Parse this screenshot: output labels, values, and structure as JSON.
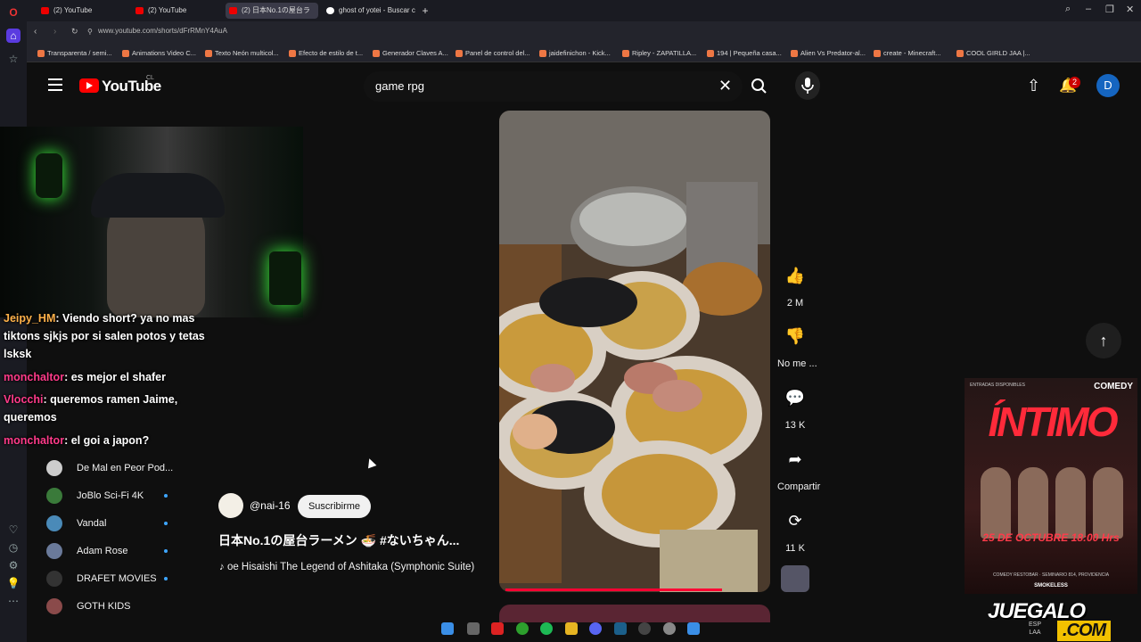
{
  "browser": {
    "tabs": [
      {
        "label": "(2) YouTube",
        "active": false
      },
      {
        "label": "(2) YouTube",
        "active": false
      },
      {
        "label": "(2) 日本No.1の屋台ラ",
        "active": true
      },
      {
        "label": "ghost of yotei - Buscar co",
        "active": false
      }
    ],
    "url": "www.youtube.com/shorts/dFrRMnY4AuA",
    "bookmarks": [
      "Transparenta / semi...",
      "Animations Video C...",
      "Texto Neón multicol...",
      "Efecto de estilo de t...",
      "Generador Claves A...",
      "Panel de control del...",
      "jaidefinichon - Kick...",
      "Ripley - ZAPATILLA...",
      "194 | Pequeña casa...",
      "Alien Vs Predator-al...",
      "create - Minecraft...",
      "COOL GIRLD JAA |..."
    ]
  },
  "header": {
    "brand": "YouTube",
    "country": "CL",
    "search_value": "game rpg",
    "notifications": "2",
    "avatar": "D"
  },
  "sidebar": {
    "subs": [
      {
        "name": "De Mal en Peor Pod...",
        "dot": false
      },
      {
        "name": "JoBlo Sci-Fi 4K",
        "dot": true
      },
      {
        "name": "Vandal",
        "dot": true
      },
      {
        "name": "Adam Rose",
        "dot": true
      },
      {
        "name": "DRAFET MOVIES",
        "dot": true
      },
      {
        "name": "GOTH KIDS",
        "dot": false
      }
    ]
  },
  "chat": [
    {
      "user": "Jeipy_HM",
      "text": ": Viendo short? ya no mas tiktons sjkjs por si salen potos y tetas lsksk"
    },
    {
      "user": "monchaltor",
      "text": ": es mejor el shafer"
    },
    {
      "user": "Vlocchi",
      "text": ": queremos ramen Jaime, queremos"
    },
    {
      "user": "monchaltor",
      "text": ": el goi a japon?"
    }
  ],
  "short": {
    "channel": "@nai-16",
    "subscribe_label": "Suscribirme",
    "title": "日本No.1の屋台ラーメン 🍜 #ないちゃん...",
    "music": "♪ oe Hisaishi    The Legend of Ashitaka (Symphonic Suite)",
    "likes": "2 M",
    "dislike_label": "No me ...",
    "comments": "13 K",
    "share_label": "Compartir",
    "remix": "11 K",
    "progress": 0.82
  },
  "promo": {
    "tag": "ENTRADAS DISPONIBLES",
    "comedy": "COMEDY",
    "title": "ÍNTIMO",
    "date": "25 DE OCTUBRE 18:00 Hrs",
    "location": "COMEDY RESTOBAR · SEMINARIO 814, PROVIDENCIA",
    "brand": "SMOKELESS"
  },
  "watermark": {
    "line1": "JUEGALO",
    "line2": ".COM"
  },
  "tray": {
    "lang": "ESP LAA"
  }
}
